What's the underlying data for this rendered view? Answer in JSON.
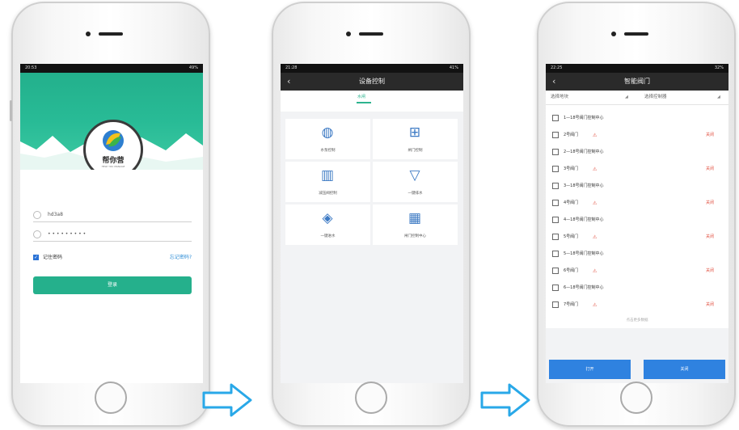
{
  "screen1": {
    "status_time": "20:53",
    "status_right": "49%",
    "brand": "帮你营",
    "brand_sub": "HELP YOU MANAGE",
    "username": "hd3a8",
    "password_mask": "• • • • • • • • •",
    "remember_label": "记住密码",
    "forgot_label": "忘记密码?",
    "login_label": "登录"
  },
  "screen2": {
    "status_time": "21:28",
    "status_right": "41%",
    "title": "设备控制",
    "tab": "水闸",
    "tiles": [
      {
        "label": "水泵控制",
        "icon": "globe-icon"
      },
      {
        "label": "闸门控制",
        "icon": "gate-icon"
      },
      {
        "label": "减压阀控制",
        "icon": "tower-icon"
      },
      {
        "label": "一键排水",
        "icon": "drain-icon"
      },
      {
        "label": "一键进水",
        "icon": "valve-icon"
      },
      {
        "label": "闸门控制中心",
        "icon": "control-center-icon"
      }
    ]
  },
  "screen3": {
    "status_time": "22:25",
    "status_right": "32%",
    "title": "智能阀门",
    "filter_area": "选择地块",
    "filter_controller": "选择控制器",
    "items": [
      {
        "group": "1—18号阀门控制中心",
        "valve": "2号阀门",
        "status": "关闭"
      },
      {
        "group": "2—18号阀门控制中心",
        "valve": "3号阀门",
        "status": "关闭"
      },
      {
        "group": "3—18号阀门控制中心",
        "valve": "4号阀门",
        "status": "关闭"
      },
      {
        "group": "4—18号阀门控制中心",
        "valve": "5号阀门",
        "status": "关闭"
      },
      {
        "group": "5—18号阀门控制中心",
        "valve": "6号阀门",
        "status": "关闭"
      },
      {
        "group": "6—18号阀门控制中心",
        "valve": "7号阀门",
        "status": "关闭"
      }
    ],
    "load_more": "点击更多数据",
    "open_label": "打开",
    "close_label": "关闭"
  },
  "colors": {
    "green": "#25b08c",
    "blue": "#2f82e0",
    "arrow": "#29a8e8",
    "dark": "#2a2a2a"
  }
}
